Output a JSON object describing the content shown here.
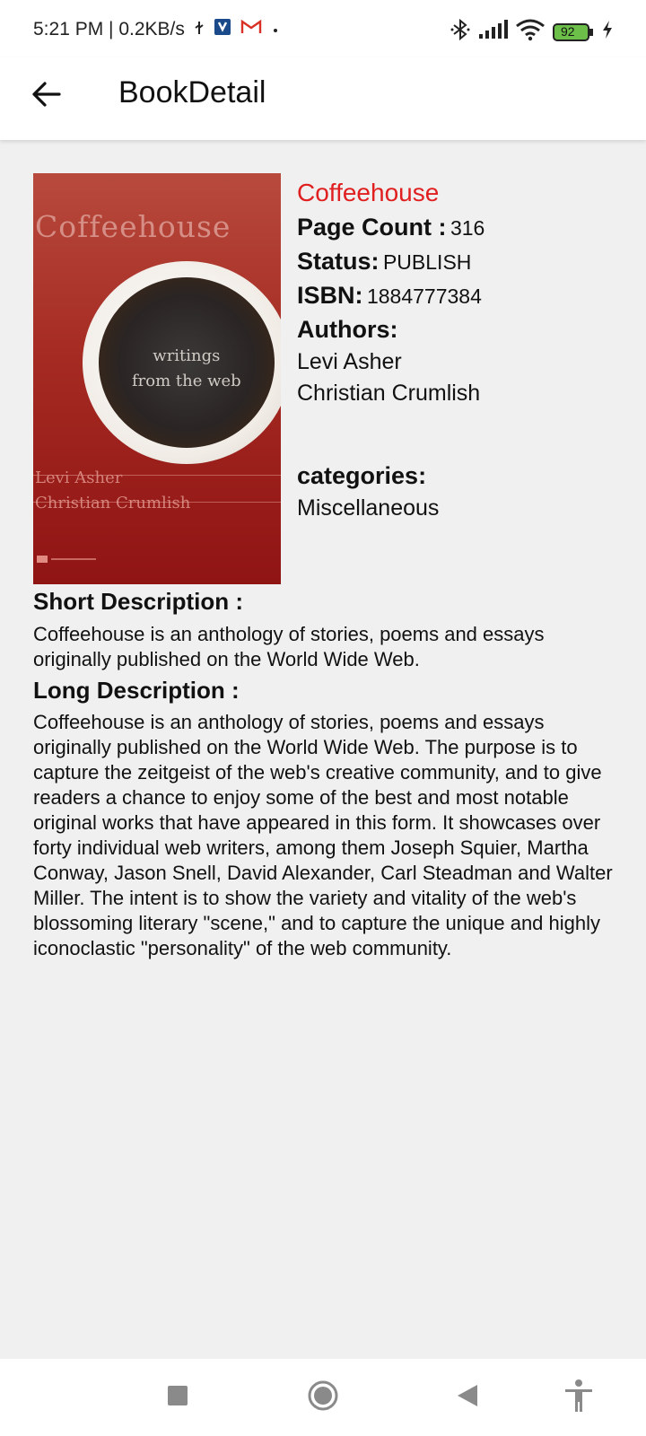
{
  "status_bar": {
    "time_speed": "5:21 PM | 0.2KB/s",
    "battery": "92",
    "icons": [
      "usb-icon",
      "app-notification-icon",
      "gmail-icon",
      "dot-icon",
      "bluetooth-icon",
      "signal-icon",
      "wifi-icon",
      "battery-icon",
      "charging-icon"
    ]
  },
  "app_bar": {
    "title": "BookDetail",
    "back_icon": "arrow-back-icon"
  },
  "cover": {
    "title": "Coffeehouse",
    "subtitle_line1": "writings",
    "subtitle_line2": "from the web",
    "author1": "Levi Asher",
    "author2": "Christian Crumlish"
  },
  "book": {
    "title": "Coffeehouse",
    "page_count_label": "Page Count :",
    "page_count": "316",
    "status_label": "Status:",
    "status": "PUBLISH",
    "isbn_label": "ISBN:",
    "isbn": "1884777384",
    "authors_label": "Authors:",
    "authors": [
      "Levi Asher",
      "Christian Crumlish"
    ],
    "categories_label": "categories:",
    "categories": [
      "Miscellaneous"
    ]
  },
  "short_description": {
    "label": "Short Description :",
    "text": "Coffeehouse is an anthology of stories, poems and essays originally published on the World Wide Web."
  },
  "long_description": {
    "label": "Long Description :",
    "text": "Coffeehouse is an anthology of stories, poems and essays originally published on the World Wide Web. The purpose is to capture the zeitgeist of the web's creative community, and to give readers a chance to enjoy some of the best and most notable original works that have appeared in this form. It showcases over forty individual web writers, among them Joseph Squier, Martha Conway, Jason Snell, David Alexander, Carl Steadman and Walter Miller. The intent is to show the variety and vitality of the web's blossoming literary \"scene,\" and to capture the unique and highly iconoclastic \"personality\" of the web community."
  },
  "nav_bar": {
    "icons": [
      "recents-square-icon",
      "home-circle-icon",
      "back-triangle-icon",
      "accessibility-icon"
    ]
  },
  "colors": {
    "title_red": "#e02020",
    "background": "#f0f0f0",
    "bar": "#ffffff"
  }
}
